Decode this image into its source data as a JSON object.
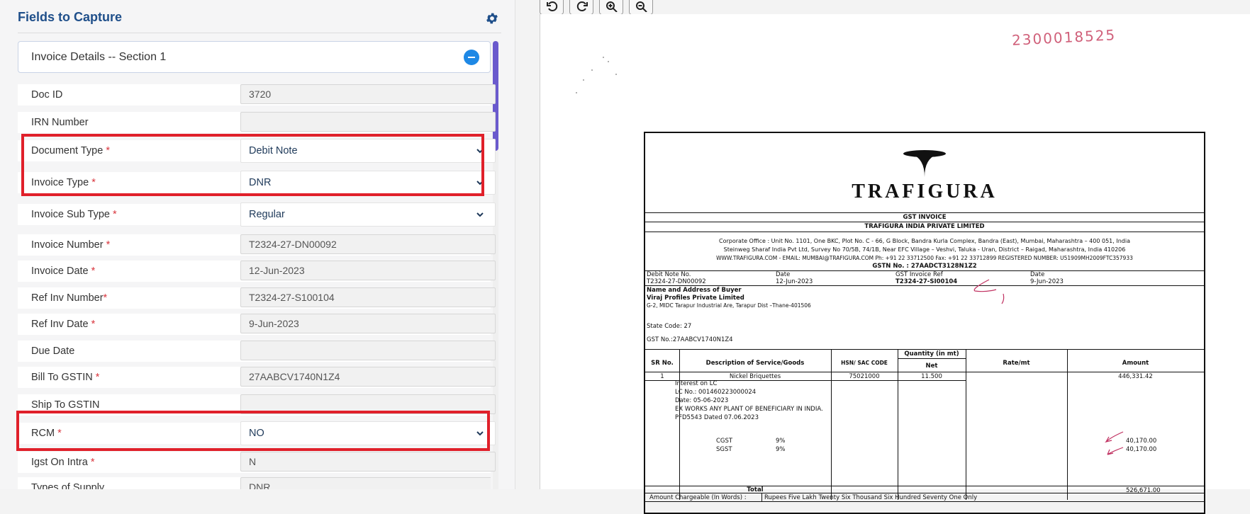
{
  "panel": {
    "title": "Fields to Capture",
    "settings_icon": "gear-icon",
    "section_title": "Invoice Details -- Section 1"
  },
  "fields": [
    {
      "label": "Doc ID",
      "required": false,
      "value": "3720",
      "kind": "input"
    },
    {
      "label": "IRN Number",
      "required": false,
      "value": "",
      "kind": "input"
    },
    {
      "label": "Document Type",
      "required": true,
      "value": "Debit Note",
      "kind": "select"
    },
    {
      "label": "Invoice Type",
      "required": true,
      "value": "DNR",
      "kind": "select"
    },
    {
      "label": "Invoice Sub Type",
      "required": true,
      "value": "Regular",
      "kind": "select"
    },
    {
      "label": "Invoice Number",
      "required": true,
      "value": "T2324-27-DN00092",
      "kind": "input"
    },
    {
      "label": "Invoice Date",
      "required": true,
      "value": "12-Jun-2023",
      "kind": "input"
    },
    {
      "label": "Ref Inv Number",
      "required": true,
      "value": "T2324-27-S100104",
      "kind": "input"
    },
    {
      "label": "Ref Inv Date",
      "required": true,
      "value": "9-Jun-2023",
      "kind": "input"
    },
    {
      "label": "Due Date",
      "required": false,
      "value": "",
      "kind": "input"
    },
    {
      "label": "Bill To GSTIN",
      "required": true,
      "value": "27AABCV1740N1Z4",
      "kind": "input"
    },
    {
      "label": "Ship To GSTIN",
      "required": false,
      "value": "",
      "kind": "input"
    },
    {
      "label": "RCM",
      "required": true,
      "value": "NO",
      "kind": "select"
    },
    {
      "label": "Igst On Intra",
      "required": true,
      "value": "N",
      "kind": "input"
    },
    {
      "label": "Types of Supply",
      "required": false,
      "value": "DNR",
      "kind": "input"
    }
  ],
  "colors": {
    "accent": "#1e88e5",
    "title": "#1f4f8a",
    "highlight": "#e0202a",
    "required": "#d9363e",
    "scroll_thumb": "#6a5acd"
  },
  "viewer": {
    "tools": [
      "rotate-left-icon",
      "rotate-right-icon",
      "zoom-in-icon",
      "zoom-out-icon"
    ],
    "handwritten_number": "2300018525"
  },
  "invoice": {
    "company": "TRAFIGURA",
    "doc_heading": "GST INVOICE",
    "company_full": "TRAFIGURA INDIA PRIVATE LIMITED",
    "address_1": "Corporate Office : Unit No. 1101, One BKC, Plot No. C - 66, G Block, Bandra Kurla Complex, Bandra (East), Mumbai, Maharashtra – 400 051, India",
    "address_2": "Steinweg Sharaf India Pvt Ltd, Survey No 70/5B, 74/1B, Near EFC Village – Veshvi, Taluka - Uran, District – Raigad, Maharashtra, India 410206",
    "address_3": "WWW.TRAFIGURA.COM - EMAIL: MUMBAI@TRAFIGURA.COM  Ph: +91 22 33712500  Fax: +91 22 33712899  REGISTERED NUMBER: U51909MH2009FTC357933",
    "gstn_line": "GSTN No. : 27AADCT3128N1Z2",
    "debit_note_label": "Debit Note No.",
    "debit_note_value": "T2324-27-DN00092",
    "date_label": "Date",
    "date_value": "12-Jun-2023",
    "gst_ref_label": "GST Invoice Ref",
    "gst_ref_value": "T2324-27-SI00104",
    "ref_date_label": "Date",
    "ref_date_value": "9-Jun-2023",
    "buyer_label": "Name and Address of Buyer",
    "buyer_name": "Viraj Profiles Private Limited",
    "buyer_addr": "G-2, MIDC Tarapur Industrial Are, Tarapur Dist –Thane-401506",
    "state_code": "State Code:  27",
    "buyer_gst": "GST No.:27AABCV1740N1Z4",
    "col_sr": "SR No.",
    "col_desc": "Description of Service/Goods",
    "col_hsn": "HSN/ SAC CODE",
    "col_qty": "Quantity (in mt)",
    "col_net": "Net",
    "col_rate": "Rate/mt",
    "col_amount": "Amount",
    "row_sr": "1",
    "row_desc": "Nickel Briquettes",
    "row_hsn": "75021000",
    "row_qty": "11.500",
    "row_amount": "446,331.42",
    "note_1": "Interest on LC",
    "note_2": "LC No.: 001460223000024",
    "note_3": "Date: 05-06-2023",
    "note_4": "EX WORKS ANY PLANT OF BENEFICIARY IN INDIA.",
    "note_5": "PFD5543 Dated 07.06.2023",
    "cgst_label": "CGST",
    "cgst_rate": "9%",
    "cgst_amount": "40,170.00",
    "sgst_label": "SGST",
    "sgst_rate": "9%",
    "sgst_amount": "40,170.00",
    "total_label": "Total",
    "total_amount": "526,671.00",
    "words_label": "Amount Chargeable (In Words) :",
    "words_value": "Rupees Five Lakh Twenty Six Thousand Six Hundred Seventy One Only"
  }
}
